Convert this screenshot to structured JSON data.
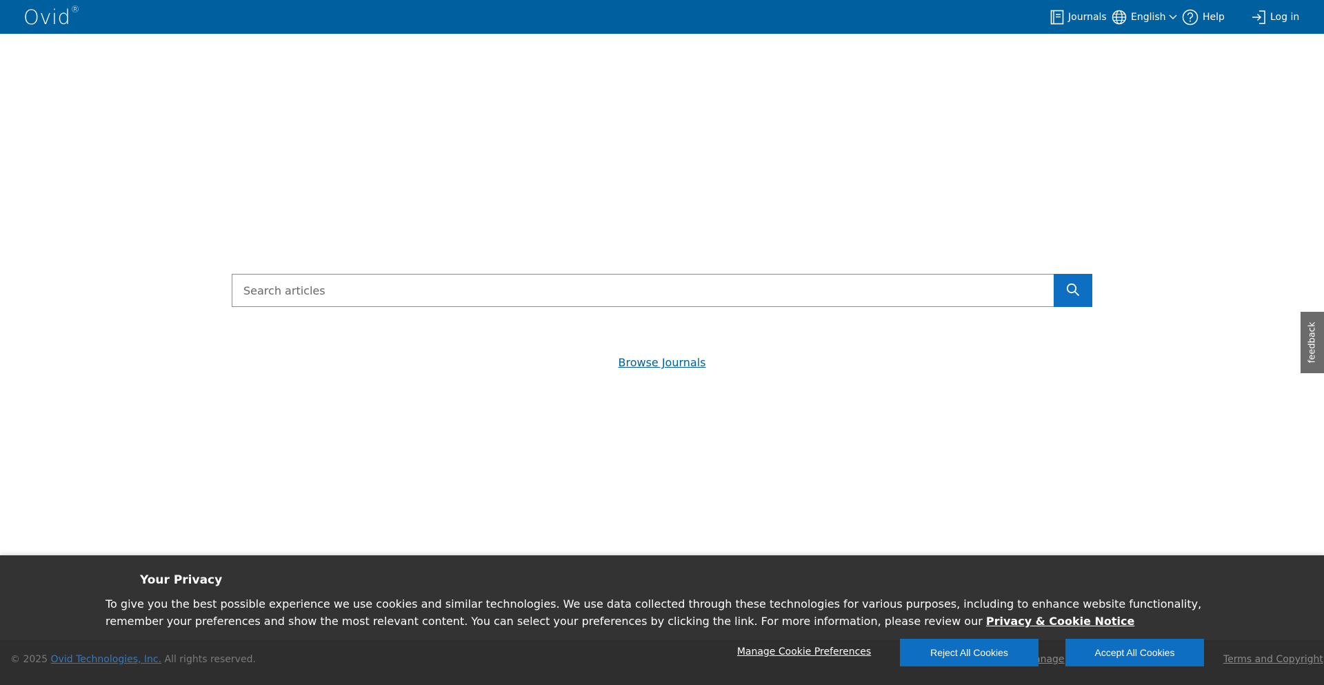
{
  "header": {
    "logo_text": "Ovid",
    "logo_mark": "®",
    "nav": {
      "journals": "Journals",
      "language": "English",
      "help": "Help",
      "login": "Log in"
    }
  },
  "search": {
    "placeholder": "Search articles",
    "value": ""
  },
  "browse_link": "Browse Journals",
  "feedback_label": "feedback",
  "footer": {
    "copyright_prefix": "© 2025 ",
    "company_link": "Ovid Technologies, Inc.",
    "copyright_suffix": " All rights reserved.",
    "manage_fragment": "anage",
    "terms_link": "Terms and Copyright"
  },
  "cookie_banner": {
    "title": "Your Privacy",
    "body": "To give you the best possible experience we use cookies and similar technologies. We use data collected through these technologies for various purposes, including to enhance website functionality, remember your preferences and show the most relevant content. You can select your preferences by clicking the link. For more information, please review our ",
    "notice_link": "Privacy & Cookie Notice",
    "manage_label": "Manage Cookie Preferences",
    "reject_label": "Reject All Cookies",
    "accept_label": "Accept All Cookies"
  },
  "colors": {
    "header_bg": "#005f9e",
    "button_blue": "#0e6fc2",
    "banner_bg": "#333333"
  },
  "icons": [
    "journal-icon",
    "globe-icon",
    "chevron-down-icon",
    "help-icon",
    "login-icon",
    "search-icon"
  ]
}
